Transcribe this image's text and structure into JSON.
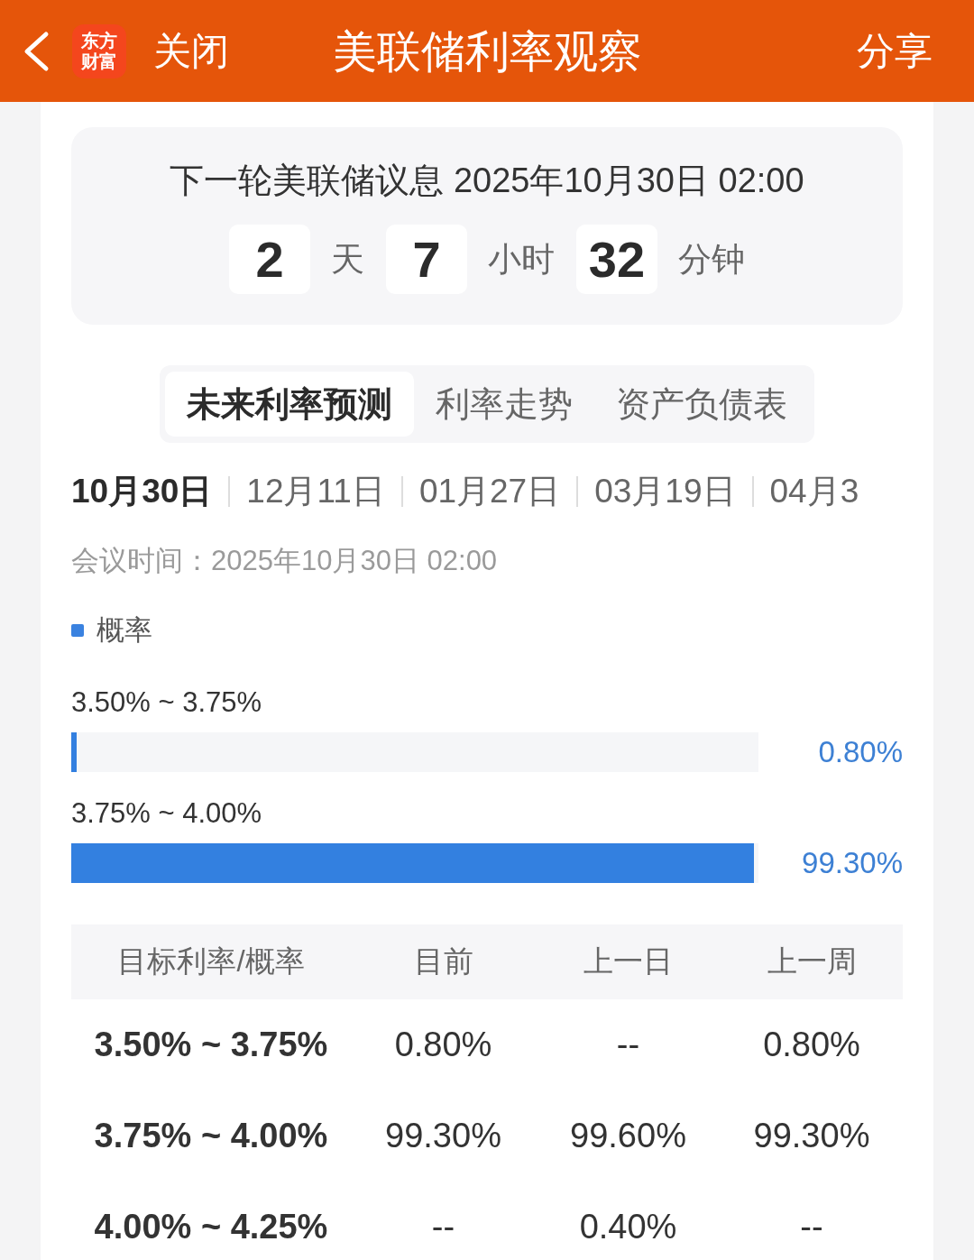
{
  "header": {
    "logo_lines": [
      "东方",
      "财富"
    ],
    "close_label": "关闭",
    "title": "美联储利率观察",
    "share_label": "分享"
  },
  "countdown": {
    "title": "下一轮美联储议息 2025年10月30日 02:00",
    "parts": [
      {
        "value": "2",
        "unit": "天"
      },
      {
        "value": "7",
        "unit": "小时"
      },
      {
        "value": "32",
        "unit": "分钟"
      }
    ]
  },
  "tabs": [
    {
      "label": "未来利率预测",
      "selected": true
    },
    {
      "label": "利率走势",
      "selected": false
    },
    {
      "label": "资产负债表",
      "selected": false
    }
  ],
  "meeting_dates": [
    {
      "label": "10月30日",
      "selected": true
    },
    {
      "label": "12月11日",
      "selected": false
    },
    {
      "label": "01月27日",
      "selected": false
    },
    {
      "label": "03月19日",
      "selected": false
    },
    {
      "label": "04月3",
      "selected": false
    }
  ],
  "meeting_time": "会议时间：2025年10月30日 02:00",
  "legend": {
    "label": "概率"
  },
  "probabilities": [
    {
      "range": "3.50% ~ 3.75%",
      "level": 0.008,
      "reading": "0.80%"
    },
    {
      "range": "3.75% ~ 4.00%",
      "level": 0.993,
      "reading": "99.30%"
    }
  ],
  "table": {
    "columns": [
      "目标利率/概率",
      "目前",
      "上一日",
      "上一周"
    ],
    "rows": [
      [
        "3.50% ~ 3.75%",
        "0.80%",
        "--",
        "0.80%"
      ],
      [
        "3.75% ~ 4.00%",
        "99.30%",
        "99.60%",
        "99.30%"
      ],
      [
        "4.00% ~ 4.25%",
        "--",
        "0.40%",
        "--"
      ]
    ]
  }
}
